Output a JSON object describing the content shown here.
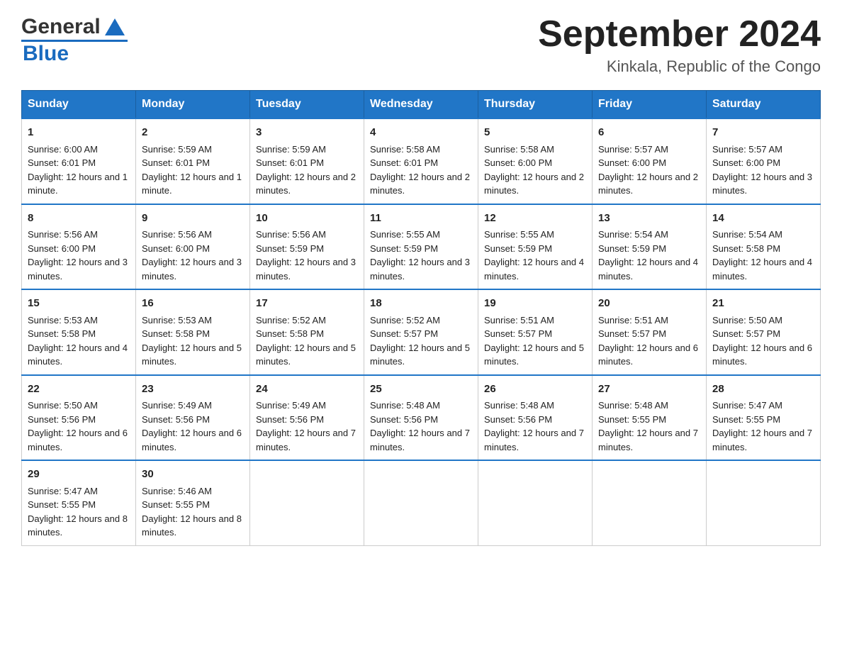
{
  "logo": {
    "general": "General",
    "blue": "Blue"
  },
  "title": "September 2024",
  "subtitle": "Kinkala, Republic of the Congo",
  "days": [
    "Sunday",
    "Monday",
    "Tuesday",
    "Wednesday",
    "Thursday",
    "Friday",
    "Saturday"
  ],
  "weeks": [
    [
      {
        "day": "1",
        "sunrise": "Sunrise: 6:00 AM",
        "sunset": "Sunset: 6:01 PM",
        "daylight": "Daylight: 12 hours and 1 minute."
      },
      {
        "day": "2",
        "sunrise": "Sunrise: 5:59 AM",
        "sunset": "Sunset: 6:01 PM",
        "daylight": "Daylight: 12 hours and 1 minute."
      },
      {
        "day": "3",
        "sunrise": "Sunrise: 5:59 AM",
        "sunset": "Sunset: 6:01 PM",
        "daylight": "Daylight: 12 hours and 2 minutes."
      },
      {
        "day": "4",
        "sunrise": "Sunrise: 5:58 AM",
        "sunset": "Sunset: 6:01 PM",
        "daylight": "Daylight: 12 hours and 2 minutes."
      },
      {
        "day": "5",
        "sunrise": "Sunrise: 5:58 AM",
        "sunset": "Sunset: 6:00 PM",
        "daylight": "Daylight: 12 hours and 2 minutes."
      },
      {
        "day": "6",
        "sunrise": "Sunrise: 5:57 AM",
        "sunset": "Sunset: 6:00 PM",
        "daylight": "Daylight: 12 hours and 2 minutes."
      },
      {
        "day": "7",
        "sunrise": "Sunrise: 5:57 AM",
        "sunset": "Sunset: 6:00 PM",
        "daylight": "Daylight: 12 hours and 3 minutes."
      }
    ],
    [
      {
        "day": "8",
        "sunrise": "Sunrise: 5:56 AM",
        "sunset": "Sunset: 6:00 PM",
        "daylight": "Daylight: 12 hours and 3 minutes."
      },
      {
        "day": "9",
        "sunrise": "Sunrise: 5:56 AM",
        "sunset": "Sunset: 6:00 PM",
        "daylight": "Daylight: 12 hours and 3 minutes."
      },
      {
        "day": "10",
        "sunrise": "Sunrise: 5:56 AM",
        "sunset": "Sunset: 5:59 PM",
        "daylight": "Daylight: 12 hours and 3 minutes."
      },
      {
        "day": "11",
        "sunrise": "Sunrise: 5:55 AM",
        "sunset": "Sunset: 5:59 PM",
        "daylight": "Daylight: 12 hours and 3 minutes."
      },
      {
        "day": "12",
        "sunrise": "Sunrise: 5:55 AM",
        "sunset": "Sunset: 5:59 PM",
        "daylight": "Daylight: 12 hours and 4 minutes."
      },
      {
        "day": "13",
        "sunrise": "Sunrise: 5:54 AM",
        "sunset": "Sunset: 5:59 PM",
        "daylight": "Daylight: 12 hours and 4 minutes."
      },
      {
        "day": "14",
        "sunrise": "Sunrise: 5:54 AM",
        "sunset": "Sunset: 5:58 PM",
        "daylight": "Daylight: 12 hours and 4 minutes."
      }
    ],
    [
      {
        "day": "15",
        "sunrise": "Sunrise: 5:53 AM",
        "sunset": "Sunset: 5:58 PM",
        "daylight": "Daylight: 12 hours and 4 minutes."
      },
      {
        "day": "16",
        "sunrise": "Sunrise: 5:53 AM",
        "sunset": "Sunset: 5:58 PM",
        "daylight": "Daylight: 12 hours and 5 minutes."
      },
      {
        "day": "17",
        "sunrise": "Sunrise: 5:52 AM",
        "sunset": "Sunset: 5:58 PM",
        "daylight": "Daylight: 12 hours and 5 minutes."
      },
      {
        "day": "18",
        "sunrise": "Sunrise: 5:52 AM",
        "sunset": "Sunset: 5:57 PM",
        "daylight": "Daylight: 12 hours and 5 minutes."
      },
      {
        "day": "19",
        "sunrise": "Sunrise: 5:51 AM",
        "sunset": "Sunset: 5:57 PM",
        "daylight": "Daylight: 12 hours and 5 minutes."
      },
      {
        "day": "20",
        "sunrise": "Sunrise: 5:51 AM",
        "sunset": "Sunset: 5:57 PM",
        "daylight": "Daylight: 12 hours and 6 minutes."
      },
      {
        "day": "21",
        "sunrise": "Sunrise: 5:50 AM",
        "sunset": "Sunset: 5:57 PM",
        "daylight": "Daylight: 12 hours and 6 minutes."
      }
    ],
    [
      {
        "day": "22",
        "sunrise": "Sunrise: 5:50 AM",
        "sunset": "Sunset: 5:56 PM",
        "daylight": "Daylight: 12 hours and 6 minutes."
      },
      {
        "day": "23",
        "sunrise": "Sunrise: 5:49 AM",
        "sunset": "Sunset: 5:56 PM",
        "daylight": "Daylight: 12 hours and 6 minutes."
      },
      {
        "day": "24",
        "sunrise": "Sunrise: 5:49 AM",
        "sunset": "Sunset: 5:56 PM",
        "daylight": "Daylight: 12 hours and 7 minutes."
      },
      {
        "day": "25",
        "sunrise": "Sunrise: 5:48 AM",
        "sunset": "Sunset: 5:56 PM",
        "daylight": "Daylight: 12 hours and 7 minutes."
      },
      {
        "day": "26",
        "sunrise": "Sunrise: 5:48 AM",
        "sunset": "Sunset: 5:56 PM",
        "daylight": "Daylight: 12 hours and 7 minutes."
      },
      {
        "day": "27",
        "sunrise": "Sunrise: 5:48 AM",
        "sunset": "Sunset: 5:55 PM",
        "daylight": "Daylight: 12 hours and 7 minutes."
      },
      {
        "day": "28",
        "sunrise": "Sunrise: 5:47 AM",
        "sunset": "Sunset: 5:55 PM",
        "daylight": "Daylight: 12 hours and 7 minutes."
      }
    ],
    [
      {
        "day": "29",
        "sunrise": "Sunrise: 5:47 AM",
        "sunset": "Sunset: 5:55 PM",
        "daylight": "Daylight: 12 hours and 8 minutes."
      },
      {
        "day": "30",
        "sunrise": "Sunrise: 5:46 AM",
        "sunset": "Sunset: 5:55 PM",
        "daylight": "Daylight: 12 hours and 8 minutes."
      },
      null,
      null,
      null,
      null,
      null
    ]
  ]
}
